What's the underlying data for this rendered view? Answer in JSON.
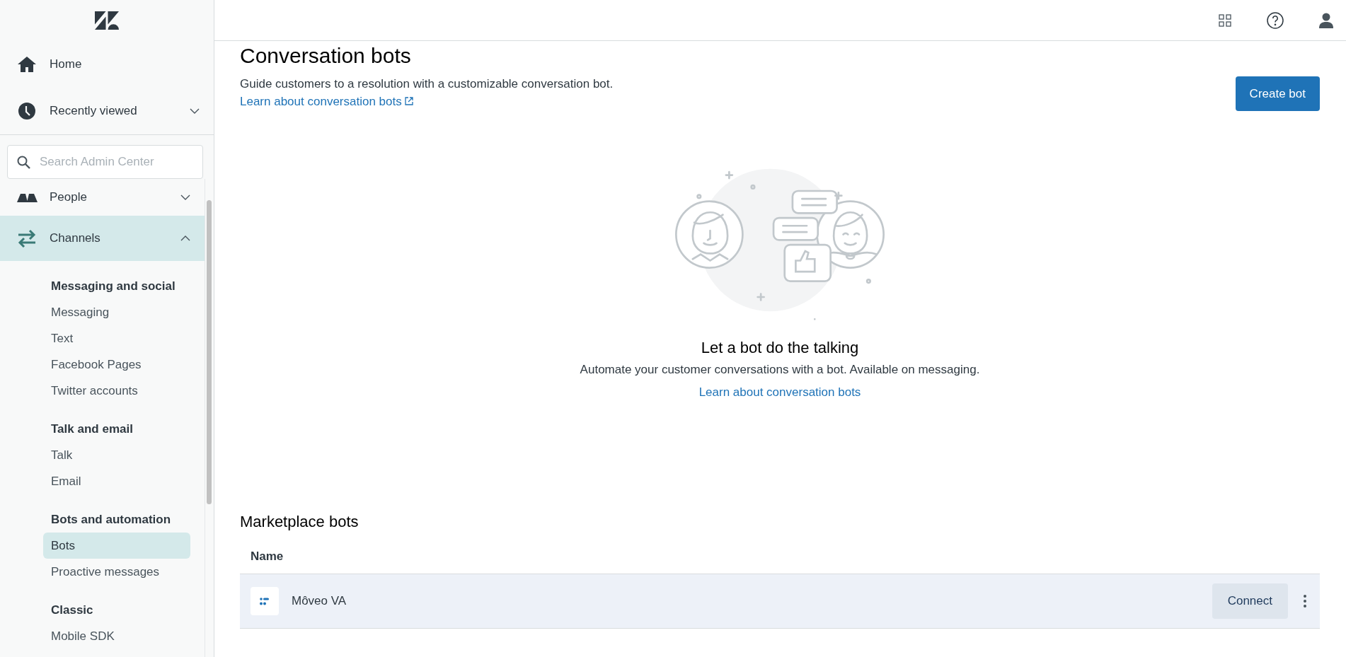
{
  "sidebar": {
    "top_items": [
      {
        "label": "Home",
        "kind": "link"
      },
      {
        "label": "Recently viewed",
        "kind": "group",
        "expanded": false
      }
    ],
    "search": {
      "placeholder": "Search Admin Center"
    },
    "nav_items": [
      {
        "label": "People",
        "expanded": false,
        "selected": false
      },
      {
        "label": "Channels",
        "expanded": true,
        "selected": true
      }
    ],
    "sections": [
      {
        "heading": "Messaging and social",
        "items": [
          {
            "label": "Messaging",
            "selected": false
          },
          {
            "label": "Text",
            "selected": false
          },
          {
            "label": "Facebook Pages",
            "selected": false
          },
          {
            "label": "Twitter accounts",
            "selected": false
          }
        ]
      },
      {
        "heading": "Talk and email",
        "items": [
          {
            "label": "Talk",
            "selected": false
          },
          {
            "label": "Email",
            "selected": false
          }
        ]
      },
      {
        "heading": "Bots and automation",
        "items": [
          {
            "label": "Bots",
            "selected": true
          },
          {
            "label": "Proactive messages",
            "selected": false
          }
        ]
      },
      {
        "heading": "Classic",
        "items": [
          {
            "label": "Mobile SDK",
            "selected": false
          }
        ]
      }
    ]
  },
  "page": {
    "title": "Conversation bots",
    "description": "Guide customers to a resolution with a customizable conversation bot.",
    "description_link": "Learn about conversation bots",
    "primary_button": "Create bot"
  },
  "empty_state": {
    "heading": "Let a bot do the talking",
    "text": "Automate your customer conversations with a bot. Available on messaging.",
    "link": "Learn about conversation bots"
  },
  "marketplace": {
    "title": "Marketplace bots",
    "columns": [
      "Name"
    ],
    "rows": [
      {
        "name": "Môveo VA",
        "action": "Connect",
        "selected": true
      }
    ]
  }
}
